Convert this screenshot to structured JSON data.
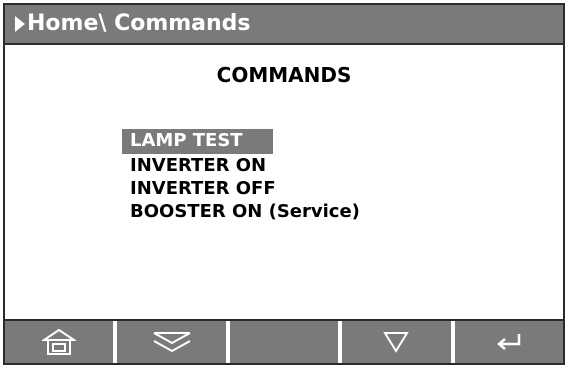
{
  "header": {
    "breadcrumb": "Home\\ Commands"
  },
  "main": {
    "title": "COMMANDS",
    "items": [
      {
        "label": "LAMP TEST",
        "selected": true
      },
      {
        "label": "INVERTER ON",
        "selected": false
      },
      {
        "label": "INVERTER OFF",
        "selected": false
      },
      {
        "label": "BOOSTER ON (Service)",
        "selected": false
      }
    ]
  },
  "softkeys": [
    {
      "icon": "home-icon"
    },
    {
      "icon": "double-chevron-down-icon"
    },
    {
      "icon": "blank"
    },
    {
      "icon": "down-triangle-icon"
    },
    {
      "icon": "enter-icon"
    }
  ],
  "colors": {
    "bar": "#7a7a7a",
    "highlight": "#7a7a7a",
    "border": "#2a2a2a"
  }
}
